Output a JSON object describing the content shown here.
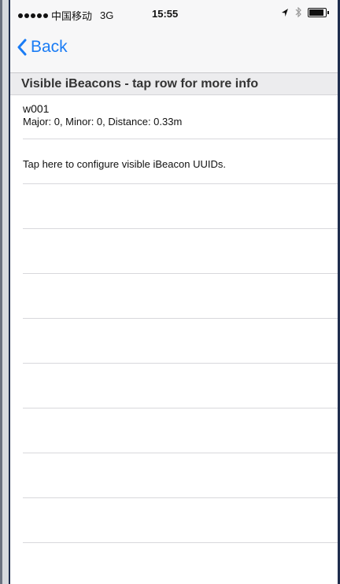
{
  "status_bar": {
    "carrier": "中国移动",
    "network": "3G",
    "time": "15:55"
  },
  "nav": {
    "back_label": "Back"
  },
  "section": {
    "header": "Visible iBeacons - tap row for more info"
  },
  "beacons": [
    {
      "name": "w001",
      "detail": "Major: 0, Minor: 0, Distance: 0.33m"
    }
  ],
  "config_row": {
    "label": "Tap here to configure visible iBeacon UUIDs."
  },
  "colors": {
    "accent": "#1a7cf5",
    "separator": "#d8d8dc",
    "section_bg": "#ececee"
  },
  "icons": {
    "back": "chevron-left-icon",
    "location": "location-arrow-icon",
    "bluetooth": "bluetooth-icon",
    "battery": "battery-icon"
  }
}
